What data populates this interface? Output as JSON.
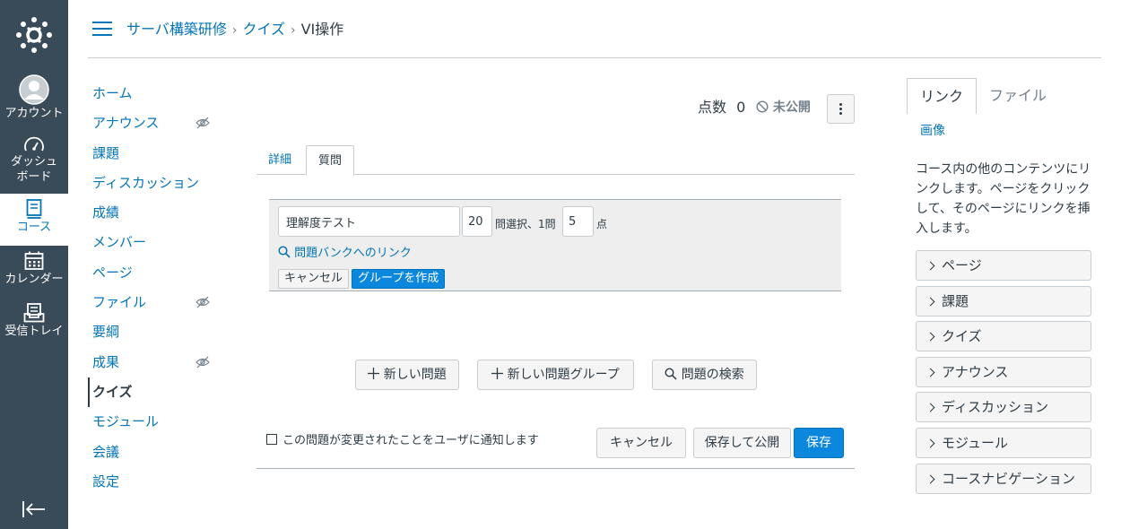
{
  "global_nav": {
    "items": [
      {
        "label": "アカウント",
        "icon": "avatar-icon"
      },
      {
        "label": "ダッシュボード",
        "label_line1": "ダッシュ",
        "label_line2": "ボード",
        "icon": "dashboard-icon"
      },
      {
        "label": "コース",
        "icon": "courses-icon"
      },
      {
        "label": "カレンダー",
        "icon": "calendar-icon"
      },
      {
        "label": "受信トレイ",
        "icon": "inbox-icon"
      }
    ],
    "active_color": "#0374b5",
    "background": "#394b58"
  },
  "breadcrumb": {
    "course": "サーバ構築研修",
    "section": "クイズ",
    "current": "VI操作",
    "separator": "›"
  },
  "course_nav": {
    "items": [
      {
        "label": "ホーム"
      },
      {
        "label": "アナウンス",
        "hidden": true
      },
      {
        "label": "課題"
      },
      {
        "label": "ディスカッション"
      },
      {
        "label": "成績"
      },
      {
        "label": "メンバー"
      },
      {
        "label": "ページ"
      },
      {
        "label": "ファイル",
        "hidden": true
      },
      {
        "label": "要綱"
      },
      {
        "label": "成果",
        "hidden": true
      },
      {
        "label": "クイズ",
        "active": true
      },
      {
        "label": "モジュール"
      },
      {
        "label": "会議"
      },
      {
        "label": "設定"
      }
    ]
  },
  "quiz": {
    "points_label": "点数",
    "points_value": "0",
    "status": "未公開",
    "tabs": [
      {
        "label": "詳細"
      },
      {
        "label": "質問",
        "active": true
      }
    ],
    "group_form": {
      "name_value": "理解度テスト",
      "pick_count": "20",
      "pick_label": "問選択、1問",
      "points_per": "5",
      "points_unit": "点",
      "bank_link": "問題バンクへのリンク",
      "cancel_label": "キャンセル",
      "create_label": "グループを作成"
    },
    "actions": {
      "new_question": "新しい問題",
      "new_group": "新しい問題グループ",
      "find_questions": "問題の検索"
    },
    "notify_label": "この問題が変更されたことをユーザに通知します",
    "notify_checked": false,
    "footer": {
      "cancel": "キャンセル",
      "save_publish": "保存して公開",
      "save": "保存"
    }
  },
  "right_sidebar": {
    "tabs": [
      {
        "label": "リンク",
        "active": true
      },
      {
        "label": "ファイル"
      }
    ],
    "image_link": "画像",
    "description": "コース内の他のコンテンツにリンクします。ページをクリックして、そのページにリンクを挿入します。",
    "accordion": [
      {
        "label": "ページ"
      },
      {
        "label": "課題"
      },
      {
        "label": "クイズ"
      },
      {
        "label": "アナウンス"
      },
      {
        "label": "ディスカッション"
      },
      {
        "label": "モジュール"
      },
      {
        "label": "コースナビゲーション"
      }
    ]
  },
  "colors": {
    "link": "#0374b5",
    "primary_button": "#0b87de",
    "text": "#2d3b45",
    "muted": "#73818c"
  }
}
